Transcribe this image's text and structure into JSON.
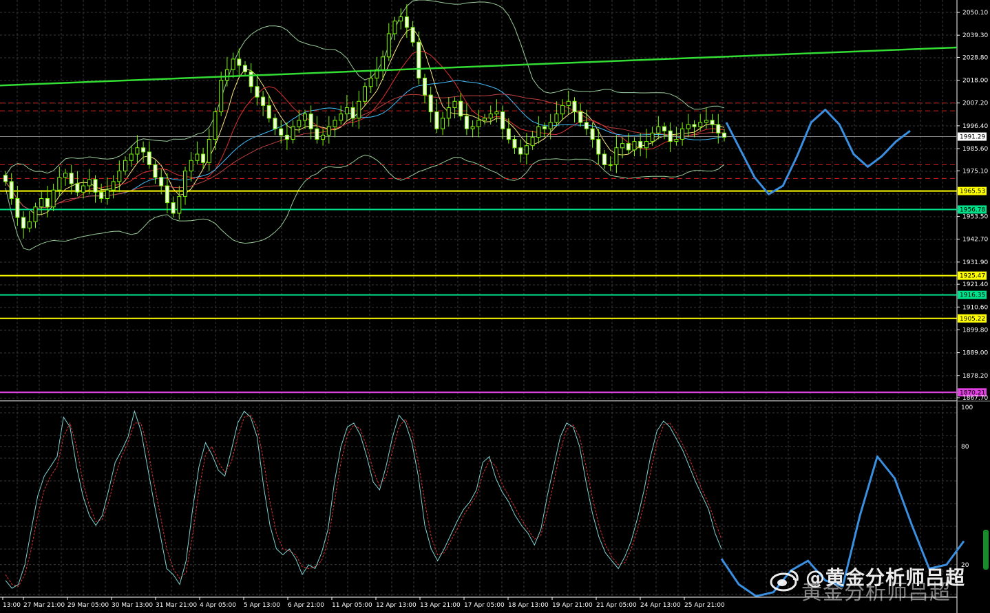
{
  "chart_data": [
    {
      "type": "candlestick",
      "instrument_note": "",
      "price_axis_ticks": [
        "2050.10",
        "2039.30",
        "2028.80",
        "2018.00",
        "2007.20",
        "1996.40",
        "1985.60",
        "1975.10",
        "1953.50",
        "1942.70",
        "1931.90",
        "1921.40",
        "1910.60",
        "1899.80",
        "1889.00",
        "1878.20",
        "1867.70"
      ],
      "time_axis_labels": [
        "13:00",
        "27 Mar 21:00",
        "29 Mar 05:00",
        "30 Mar 13:00",
        "31 Mar 21:00",
        "4 Apr 05:00",
        "5 Apr 13:00",
        "6 Apr 21:00",
        "11 Apr 05:00",
        "12 Apr 13:00",
        "13 Apr 21:00",
        "17 Apr 05:00",
        "18 Apr 13:00",
        "19 Apr 21:00",
        "21 Apr 05:00",
        "24 Apr 13:00",
        "25 Apr 21:00"
      ],
      "current_price": "1991.29",
      "horizontal_levels": [
        {
          "label": "1965.53",
          "color": "#ffff00"
        },
        {
          "label": "1956.78",
          "color": "#00e08a"
        },
        {
          "label": "1925.47",
          "color": "#ffff00"
        },
        {
          "label": "1916.35",
          "color": "#00e08a"
        },
        {
          "label": "1905.22",
          "color": "#ffff00"
        },
        {
          "label": "1870.21",
          "color": "#e040e0"
        }
      ],
      "dashed_red_levels": [
        2007.2,
        2003.5,
        1978.0,
        1971.5
      ],
      "trendline": {
        "from_price": 2015.5,
        "to_price": 2033.5,
        "color": "#33dd33"
      },
      "close_series": [
        1970,
        1962,
        1953,
        1948,
        1951,
        1958,
        1962,
        1958,
        1966,
        1972,
        1974,
        1969,
        1965,
        1968,
        1971,
        1965,
        1962,
        1966,
        1970,
        1975,
        1980,
        1983,
        1986,
        1984,
        1978,
        1972,
        1968,
        1960,
        1955,
        1963,
        1975,
        1980,
        1983,
        1979,
        1990,
        2003,
        2018,
        2023,
        2028,
        2025,
        2022,
        2015,
        2010,
        2006,
        2000,
        1995,
        1992,
        1990,
        1996,
        1999,
        2002,
        1995,
        1990,
        1992,
        1996,
        1999,
        2002,
        2005,
        2000,
        2008,
        2015,
        2019,
        2023,
        2029,
        2040,
        2046,
        2048,
        2043,
        2036,
        2019,
        2011,
        2003,
        1995,
        2000,
        2005,
        2008,
        2001,
        1995,
        1996,
        1999,
        2000,
        2002,
        2003,
        1995,
        1990,
        1986,
        1983,
        1987,
        1991,
        1996,
        1995,
        1998,
        2002,
        2006,
        2008,
        2003,
        1998,
        1995,
        1990,
        1983,
        1978,
        1978,
        1986,
        1988,
        1985,
        1989,
        1986,
        1989,
        1993,
        1996,
        1994,
        1989,
        1990,
        1995,
        1997,
        1996,
        1998,
        1999,
        1997,
        1993,
        1991
      ],
      "bollinger_upper_peak": 2054,
      "bollinger_lower_trough": 1940,
      "forecast_path_prices": [
        1998,
        1985,
        1972,
        1964,
        1968,
        1982,
        1998,
        2004,
        1997,
        1983,
        1977,
        1982,
        1989,
        1994
      ]
    },
    {
      "type": "line",
      "indicator": "stochastic",
      "ylim": [
        0,
        100
      ],
      "y_ticks": [
        "100",
        "80",
        "20"
      ],
      "main_values": [
        12,
        8,
        10,
        20,
        38,
        55,
        65,
        70,
        75,
        95,
        90,
        70,
        55,
        45,
        40,
        45,
        58,
        72,
        78,
        85,
        98,
        88,
        70,
        52,
        35,
        18,
        15,
        10,
        22,
        48,
        70,
        82,
        76,
        68,
        65,
        78,
        92,
        98,
        95,
        85,
        60,
        40,
        28,
        25,
        28,
        23,
        15,
        20,
        18,
        26,
        38,
        62,
        80,
        90,
        92,
        86,
        75,
        62,
        58,
        70,
        85,
        96,
        92,
        82,
        65,
        40,
        28,
        22,
        28,
        35,
        42,
        48,
        52,
        58,
        72,
        75,
        64,
        57,
        52,
        45,
        40,
        36,
        30,
        38,
        55,
        70,
        85,
        92,
        90,
        80,
        62,
        46,
        34,
        26,
        22,
        18,
        24,
        32,
        44,
        58,
        75,
        88,
        93,
        90,
        84,
        78,
        70,
        62,
        55,
        48,
        36,
        28
      ],
      "signal_values": [
        15,
        10,
        9,
        15,
        28,
        45,
        58,
        65,
        70,
        85,
        92,
        80,
        62,
        50,
        42,
        43,
        52,
        65,
        75,
        82,
        92,
        92,
        80,
        62,
        45,
        28,
        18,
        13,
        16,
        35,
        58,
        76,
        80,
        72,
        67,
        72,
        85,
        95,
        96,
        90,
        73,
        52,
        36,
        28,
        27,
        25,
        19,
        18,
        19,
        22,
        32,
        52,
        72,
        86,
        91,
        89,
        80,
        68,
        60,
        65,
        78,
        90,
        94,
        87,
        72,
        52,
        34,
        25,
        26,
        32,
        38,
        45,
        50,
        55,
        66,
        73,
        70,
        61,
        55,
        49,
        43,
        38,
        33,
        35,
        47,
        62,
        78,
        89,
        91,
        85,
        70,
        54,
        40,
        30,
        24,
        20,
        21,
        28,
        38,
        51,
        67,
        82,
        91,
        92,
        87,
        81,
        74,
        66,
        58,
        51,
        42,
        33
      ],
      "forecast_path_values": [
        23,
        10,
        4,
        6,
        17,
        22,
        12,
        9,
        45,
        75,
        64,
        40,
        18,
        20,
        32
      ]
    }
  ],
  "watermark": {
    "line1": "@黄金分析师吕超",
    "line2": "黄金分析师吕超"
  }
}
